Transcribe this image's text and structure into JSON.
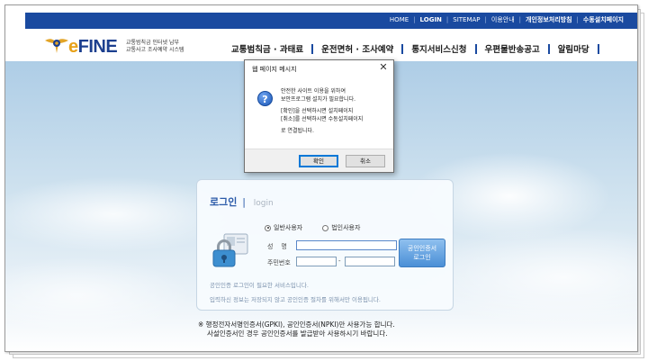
{
  "topnav": {
    "links": [
      "HOME",
      "LOGIN",
      "SITEMAP",
      "이용안내",
      "개인정보처리방침",
      "수동설치페이지"
    ]
  },
  "logo": {
    "text": "eFINE",
    "sub_line1": "교통범칙금 인터넷 납부",
    "sub_line2": "교통사고 조사예약 시스템"
  },
  "mainnav": {
    "items": [
      "교통범칙금 · 과태료",
      "운전면허 · 조사예약",
      "통지서비스신청",
      "우편물반송공고",
      "알림마당"
    ]
  },
  "login": {
    "title": "로그인",
    "divider": "|",
    "title_en": "login",
    "radio_individual": "일반사용자",
    "radio_corporate": "법인사용자",
    "name_label": "성    명",
    "rrn_label": "주민번호",
    "rrn_dash": "-",
    "cert_button_line1": "공인인증서",
    "cert_button_line2": "로그인",
    "note1": "공인인증 로그인이 필요한 서비스입니다.",
    "note2": "입력하신 정보는 저장되지 않고 공인인증 절차를 위해서만 이용됩니다."
  },
  "warning": {
    "line1": "※ 행정전자서명인증서(GPKI), 공인인증서(NPKI)만 사용가능 합니다.",
    "line2": "사설인증서인 경우 공인인증서를 발급받아 사용하시기 바랍니다."
  },
  "dialog": {
    "title": "웹 페이지 메시지",
    "close": "✕",
    "icon_glyph": "?",
    "msg1": "안전한 사이트 이용을 위하여",
    "msg2": "보안프로그램 설치가 필요합니다.",
    "msg3": "[확인]을 선택하시면 설치페이지",
    "msg4": "[취소]를 선택하시면 수동설치페이지",
    "msg5": "로 연결됩니다.",
    "ok_label": "확인",
    "cancel_label": "취소"
  },
  "colors": {
    "topbar": "#1a4aa0",
    "accent": "#2a5aa8"
  }
}
